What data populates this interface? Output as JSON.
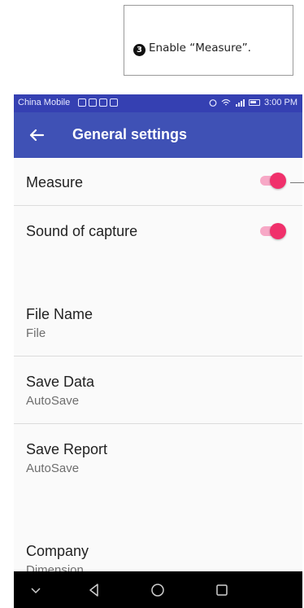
{
  "callout": {
    "number": "3",
    "text": "Enable “Measure”."
  },
  "status_bar": {
    "carrier": "China Mobile",
    "time": "3:00 PM"
  },
  "app_bar": {
    "title": "General settings"
  },
  "settings": {
    "measure": {
      "label": "Measure",
      "enabled": true
    },
    "sound_of_capture": {
      "label": "Sound of capture",
      "enabled": true
    },
    "file_name": {
      "label": "File Name",
      "value": "File"
    },
    "save_data": {
      "label": "Save Data",
      "value": "AutoSave"
    },
    "save_report": {
      "label": "Save Report",
      "value": "AutoSave"
    },
    "company": {
      "label": "Company",
      "value": "Dimension"
    }
  },
  "colors": {
    "app_bar": "#3f51b5",
    "status_bar": "#3540b2",
    "switch_thumb": "#f0306b",
    "switch_track": "#f7a8c6"
  },
  "icons": {
    "back": "arrow-left-icon",
    "nav_hide": "chevron-down-icon",
    "nav_back": "triangle-back-icon",
    "nav_home": "circle-home-icon",
    "nav_recents": "square-recents-icon"
  }
}
